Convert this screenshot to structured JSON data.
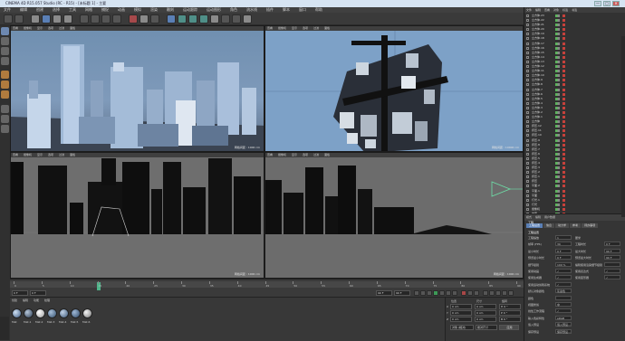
{
  "window": {
    "title": "CINEMA 4D R15.057 Studio (RC - R15) - [未标题 1] - 主要",
    "controls": [
      "—",
      "□",
      "✕"
    ]
  },
  "menubar": [
    "文件",
    "编辑",
    "创建",
    "选择",
    "工具",
    "网格",
    "捕捉",
    "动画",
    "模拟",
    "渲染",
    "雕刻",
    "运动跟踪",
    "运动图形",
    "角色",
    "流水线",
    "插件",
    "脚本",
    "窗口",
    "帮助"
  ],
  "viewports": {
    "menu": [
      "查看",
      "摄像机",
      "显示",
      "选项",
      "过滤",
      "面板"
    ],
    "perspective": {
      "label": "透视视图",
      "footer": "网格间距 : 1000 cm"
    },
    "top": {
      "label": "顶视图",
      "footer": "网格间距 : 10000 cm"
    },
    "right": {
      "label": "右视图",
      "footer": "网格间距 : 1000 cm"
    },
    "front": {
      "label": "正视图",
      "footer": "网格间距 : 1000 cm"
    }
  },
  "timeline": {
    "ticks": [
      "0",
      "5",
      "10",
      "15",
      "20",
      "25",
      "30",
      "35",
      "40",
      "45",
      "50",
      "55",
      "60",
      "65",
      "70",
      "75",
      "80",
      "85",
      "90"
    ],
    "current_frame": "0 F",
    "start_frame": "0 F",
    "end_frame": "90 F",
    "max_frame": "90 F",
    "frame_readout": "0 F"
  },
  "material_manager": {
    "menu": [
      "创建",
      "编辑",
      "功能",
      "纹理"
    ],
    "materials": [
      "Mat",
      "Mat.1",
      "Mat.2",
      "Mat.3",
      "Mat.4",
      "Mat.5",
      "Mat.6"
    ]
  },
  "coordinates": {
    "headers": [
      "位置",
      "尺寸",
      "旋转"
    ],
    "rows": [
      {
        "axis": "X",
        "pos": "0 cm",
        "size": "0 cm",
        "rot": "H 0 °"
      },
      {
        "axis": "Y",
        "pos": "0 cm",
        "size": "0 cm",
        "rot": "P 0 °"
      },
      {
        "axis": "Z",
        "pos": "0 cm",
        "size": "0 cm",
        "rot": "B 0 °"
      }
    ],
    "mode": "对象 (相对)",
    "size_mode": "绝对尺寸",
    "apply": "应用"
  },
  "object_manager": {
    "menu": [
      "文件",
      "编辑",
      "查看",
      "对象",
      "标签",
      "书签"
    ],
    "objects": [
      "立方体.23",
      "立方体.22",
      "立方体.21",
      "立方体.20",
      "立方体.19",
      "立方体.18",
      "立方体.17",
      "立方体.16",
      "立方体.15",
      "立方体.14",
      "立方体.13",
      "立方体.12",
      "立方体.11",
      "立方体.10",
      "立方体.9",
      "立方体.8",
      "立方体.7",
      "立方体.6",
      "立方体.5",
      "立方体.4",
      "立方体.3",
      "立方体.2",
      "立方体.1",
      "立方体",
      "挤压.12",
      "挤压.11",
      "挤压.10",
      "挤压.9",
      "挤压.8",
      "挤压.7",
      "挤压.6",
      "挤压.5",
      "挤压.4",
      "挤压.3",
      "挤压.2",
      "挤压.1",
      "挤压",
      "平面.2",
      "平面.1",
      "平面",
      "灯光.1",
      "灯光",
      "摄像机",
      "地面"
    ]
  },
  "attribute_manager": {
    "menu": [
      "模式",
      "编辑",
      "用户数据"
    ],
    "object_label": "工程",
    "tabs": [
      "工程设置",
      "信息",
      "动力学",
      "参考",
      "待办事项",
      "帧插值"
    ],
    "section": "工程设置",
    "fields": [
      {
        "label": "工程缩放",
        "value": "1",
        "unit": "厘米"
      },
      {
        "label": "帧率 (FPS)",
        "value": "30",
        "label2": "工程时长",
        "value2": "0 F"
      },
      {
        "label": "最小时长",
        "value": "0 F",
        "label2": "最大时长",
        "value2": "90 F"
      },
      {
        "label": "预览最小时长",
        "value": "0 F",
        "label2": "预览最大时长",
        "value2": "90 F"
      },
      {
        "label": "细节级别",
        "value": "100 %",
        "label2": "编辑使用渲染细节级别",
        "value2": ""
      },
      {
        "label": "使用动画",
        "value": "✓",
        "label2": "使用表达式",
        "value2": "✓"
      },
      {
        "label": "使用生成器",
        "value": "✓",
        "label2": "使用变形器",
        "value2": "✓"
      },
      {
        "label": "使用运动剪辑系统",
        "value": "✓",
        "label2": "",
        "value2": ""
      },
      {
        "label": "默认对象颜色",
        "value": "灰蓝色"
      },
      {
        "label": "颜色",
        "value": ""
      },
      {
        "label": "视图修剪",
        "value": "中"
      },
      {
        "label": "线性工作流程",
        "value": "✓"
      },
      {
        "label": "输入色彩特性",
        "value": "sRGB"
      },
      {
        "label": "载入预设",
        "value": "载入预设..."
      },
      {
        "label": "保存预设",
        "value": "保存预设..."
      }
    ]
  },
  "colors": {
    "accent": "#5a7fb5",
    "viewport_sky": "#7da1c7",
    "viewport_gray": "#6e6e6e",
    "ui_dark": "#3a3a3a",
    "selection_green": "#4fb58a"
  }
}
